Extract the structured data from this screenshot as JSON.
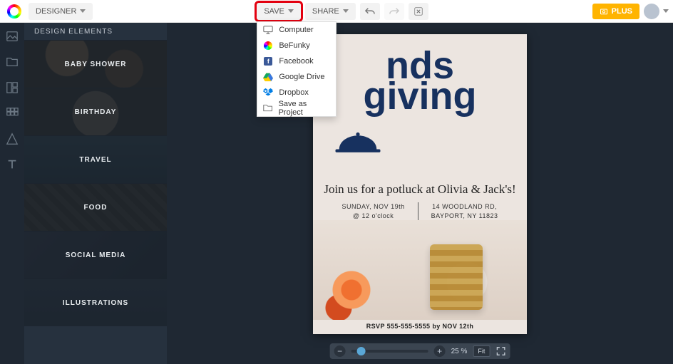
{
  "topbar": {
    "mode_label": "DESIGNER",
    "save_label": "SAVE",
    "share_label": "SHARE",
    "plus_label": "PLUS"
  },
  "save_menu": {
    "items": [
      {
        "label": "Computer",
        "icon": "monitor"
      },
      {
        "label": "BeFunky",
        "icon": "befunky"
      },
      {
        "label": "Facebook",
        "icon": "facebook"
      },
      {
        "label": "Google Drive",
        "icon": "gdrive"
      },
      {
        "label": "Dropbox",
        "icon": "dropbox"
      },
      {
        "label": "Save as Project",
        "icon": "folder"
      }
    ]
  },
  "sidepanel": {
    "title": "DESIGN ELEMENTS",
    "categories": [
      "BABY SHOWER",
      "BIRTHDAY",
      "TRAVEL",
      "FOOD",
      "SOCIAL MEDIA",
      "ILLUSTRATIONS"
    ]
  },
  "poster": {
    "headline_line1": "nds",
    "headline_line2": "giving",
    "tagline": "Join us for a potluck at Olivia & Jack's!",
    "date_line1": "SUNDAY, NOV 19th",
    "date_line2": "@ 12 o'clock",
    "addr_line1": "14 WOODLAND RD,",
    "addr_line2": "BAYPORT, NY 11823",
    "rsvp": "RSVP 555-555-5555 by NOV 12th"
  },
  "zoom": {
    "value_label": "25 %",
    "fit_label": "Fit"
  }
}
